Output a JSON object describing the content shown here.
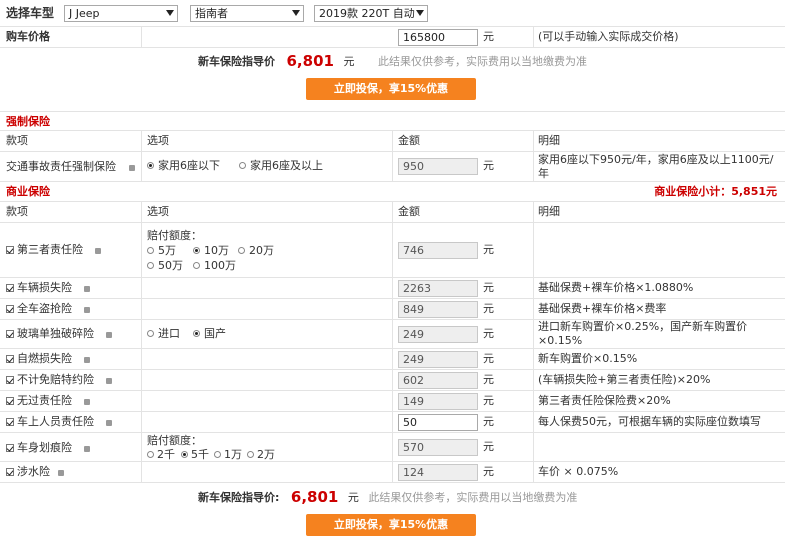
{
  "car": {
    "label": "选择车型",
    "brand": "J Jeep",
    "series": "指南者",
    "model": "2019款 220T 自动",
    "price_label": "购车价格",
    "price_value": "165800",
    "price_unit": "元",
    "price_hint": "(可以手动输入实际成交价格)"
  },
  "guide": {
    "label": "新车保险指导价",
    "label_bottom": "新车保险指导价:",
    "price": "6,801",
    "unit": "元",
    "note": "此结果仅供参考，实际费用以当地缴费为准",
    "button": "立即投保，享15%优惠"
  },
  "headers": {
    "item": "款项",
    "option": "选项",
    "amount": "金额",
    "detail": "明细"
  },
  "compulsory": {
    "title": "强制保险",
    "item": "交通事故责任强制保险",
    "opt1": "家用6座以下",
    "opt2": "家用6座及以上",
    "amount": "950",
    "unit": "元",
    "detail": "家用6座以下950元/年，家用6座及以上1100元/年"
  },
  "commercial": {
    "title": "商业保险",
    "subtotal": "商业保险小计：5,851元",
    "unit": "元",
    "third_party": {
      "name": "第三者责任险",
      "opt_label": "赔付额度：",
      "opts": [
        "5万",
        "10万",
        "20万",
        "50万",
        "100万"
      ],
      "amount": "746"
    },
    "vehicle_loss": {
      "name": "车辆损失险",
      "amount": "2263",
      "detail": "基础保费+裸车价格×1.0880%"
    },
    "theft": {
      "name": "全车盗抢险",
      "amount": "849",
      "detail": "基础保费+裸车价格×费率"
    },
    "glass": {
      "name": "玻璃单独破碎险",
      "opts": [
        "进口",
        "国产"
      ],
      "amount": "249",
      "detail": "进口新车购置价×0.25%，国产新车购置价×0.15%"
    },
    "fire": {
      "name": "自燃损失险",
      "amount": "249",
      "detail": "新车购置价×0.15%"
    },
    "deductible": {
      "name": "不计免赔特约险",
      "amount": "602",
      "detail": "(车辆损失险+第三者责任险)×20%"
    },
    "no_fault": {
      "name": "无过责任险",
      "amount": "149",
      "detail": "第三者责任险保险费×20%"
    },
    "passenger": {
      "name": "车上人员责任险",
      "amount": "50",
      "detail": "每人保费50元，可根据车辆的实际座位数填写"
    },
    "scratch": {
      "name": "车身划痕险",
      "opt_label": "赔付额度：",
      "opts": [
        "2千",
        "5千",
        "1万",
        "2万"
      ],
      "amount": "570"
    },
    "wading": {
      "name": "涉水险",
      "amount": "124",
      "detail": "车价 × 0.075%"
    }
  }
}
